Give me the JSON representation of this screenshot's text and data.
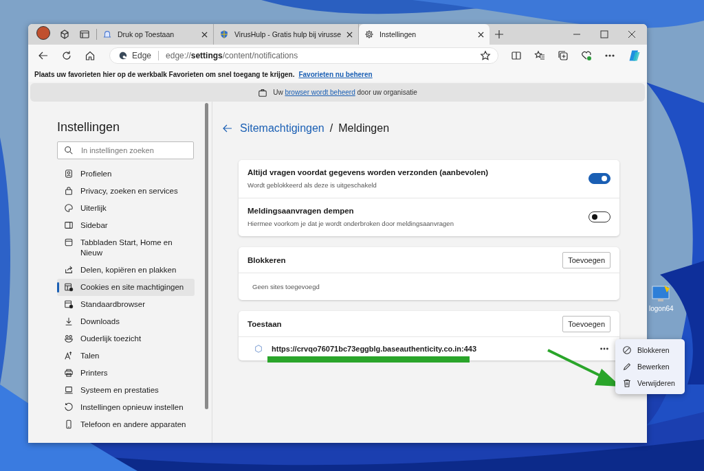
{
  "browser": {
    "tabs": [
      {
        "title": "Druk op Toestaan",
        "selected": false
      },
      {
        "title": "VirusHulp - Gratis hulp bij virusse",
        "selected": false
      },
      {
        "title": "Instellingen",
        "selected": true
      }
    ],
    "address_bar": {
      "site_label": "Edge",
      "url": "edge://**settings**/content/notifications"
    },
    "favorites_bar": {
      "text": "Plaats uw favorieten hier op de werkbalk Favorieten om snel toegang te krijgen.",
      "link": "Favorieten nu beheren"
    },
    "managed_banner": {
      "before": "Uw",
      "link": "browser wordt beheerd",
      "after": "door uw organisatie"
    }
  },
  "sidebar": {
    "title": "Instellingen",
    "search": {
      "placeholder": "In instellingen zoeken"
    },
    "items": [
      {
        "label": "Profielen",
        "selected": false
      },
      {
        "label": "Privacy, zoeken en services",
        "selected": false
      },
      {
        "label": "Uiterlijk",
        "selected": false
      },
      {
        "label": "Sidebar",
        "selected": false
      },
      {
        "label": "Tabbladen Start, Home en Nieuw",
        "selected": false
      },
      {
        "label": "Delen, kopiëren en plakken",
        "selected": false
      },
      {
        "label": "Cookies en site machtigingen",
        "selected": true
      },
      {
        "label": "Standaardbrowser",
        "selected": false
      },
      {
        "label": "Downloads",
        "selected": false
      },
      {
        "label": "Ouderlijk toezicht",
        "selected": false
      },
      {
        "label": "Talen",
        "selected": false
      },
      {
        "label": "Printers",
        "selected": false
      },
      {
        "label": "Systeem en prestaties",
        "selected": false
      },
      {
        "label": "Instellingen opnieuw instellen",
        "selected": false
      },
      {
        "label": "Telefoon en andere apparaten",
        "selected": false
      }
    ]
  },
  "main": {
    "breadcrumb": {
      "link": "Sitemachtigingen",
      "separator": "/",
      "current": "Meldingen"
    },
    "toggles": [
      {
        "title": "Altijd vragen voordat gegevens worden verzonden (aanbevolen)",
        "description": "Wordt geblokkeerd als deze is uitgeschakeld",
        "on": true
      },
      {
        "title": "Meldingsaanvragen dempen",
        "description": "Hiermee voorkom je dat je wordt onderbroken door meldingsaanvragen",
        "on": false
      }
    ],
    "sections": [
      {
        "title": "Blokkeren",
        "button": "Toevoegen",
        "empty_text": "Geen sites toegevoegd"
      },
      {
        "title": "Toestaan",
        "button": "Toevoegen",
        "sites": [
          {
            "url": "https://crvqo76071bc73eggblg.baseauthenticity.co.in:443"
          }
        ]
      }
    ]
  },
  "context_menu": {
    "items": [
      {
        "label": "Blokkeren"
      },
      {
        "label": "Bewerken"
      },
      {
        "label": "Verwijderen"
      }
    ]
  },
  "desktop": {
    "icons": [
      {
        "label": "logon64"
      }
    ]
  }
}
